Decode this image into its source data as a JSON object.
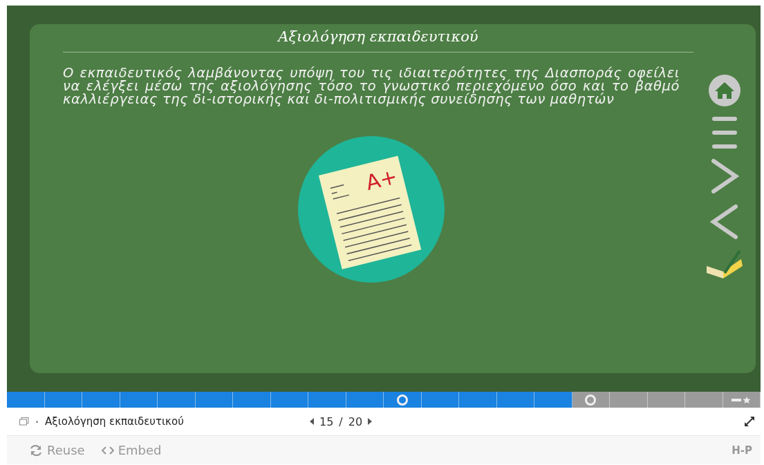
{
  "slide": {
    "title": "Αξιολόγηση εκπαιδευτικού",
    "text": "Ο εκπαιδευτικός λαμβάνοντας υπόψη του τις ιδιαιτερότητες της Διασποράς οφείλει να ελέγξει μέσω της αξιολόγησης τόσο το γνωστικό περιεχόμενο όσο και το βαθμό καλλιέργειας της δι-ιστορικής και δι-πολιτισμικής συνείδησης των μαθητών",
    "illustration_mark": "A+"
  },
  "progress": {
    "level": 0.75,
    "segments": [
      {
        "kind": "plain"
      },
      {
        "kind": "plain"
      },
      {
        "kind": "plain"
      },
      {
        "kind": "plain"
      },
      {
        "kind": "plain"
      },
      {
        "kind": "plain"
      },
      {
        "kind": "plain"
      },
      {
        "kind": "plain"
      },
      {
        "kind": "plain"
      },
      {
        "kind": "plain"
      },
      {
        "kind": "task"
      },
      {
        "kind": "plain"
      },
      {
        "kind": "plain"
      },
      {
        "kind": "plain"
      },
      {
        "kind": "plain"
      },
      {
        "kind": "task"
      },
      {
        "kind": "plain"
      },
      {
        "kind": "plain"
      },
      {
        "kind": "plain"
      },
      {
        "kind": "summary"
      }
    ]
  },
  "nav": {
    "current_title": "Αξιολόγηση εκπαιδευτικού",
    "current": "15",
    "separator": "/",
    "total": "20"
  },
  "footer": {
    "actions": [
      {
        "kind": "reuse",
        "label": "Reuse"
      },
      {
        "kind": "embed",
        "label": "Embed"
      }
    ],
    "brand": "H-P"
  }
}
